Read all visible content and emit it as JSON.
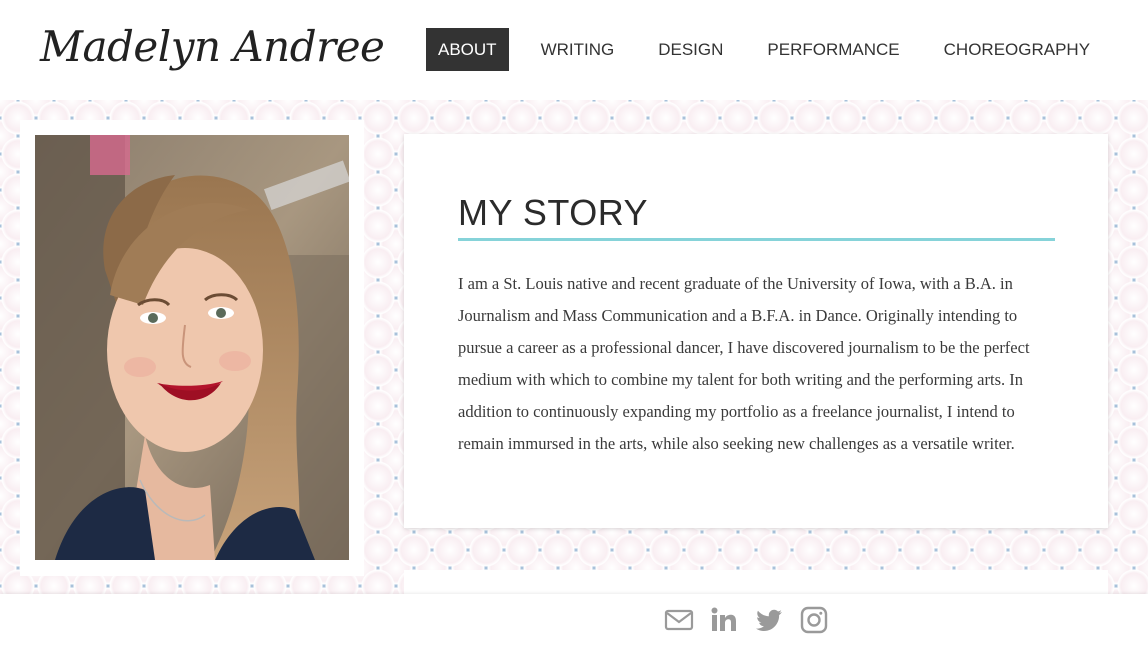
{
  "site": {
    "logo": "Madelyn Andree"
  },
  "nav": {
    "items": [
      {
        "label": "ABOUT",
        "active": true
      },
      {
        "label": "WRITING",
        "active": false
      },
      {
        "label": "DESIGN",
        "active": false
      },
      {
        "label": "PERFORMANCE",
        "active": false
      },
      {
        "label": "CHOREOGRAPHY",
        "active": false
      }
    ]
  },
  "about": {
    "title": "MY STORY",
    "body": "I am a St. Louis native and recent graduate of the University of Iowa, with a B.A. in Journalism and Mass Communication and a B.F.A. in Dance. Originally intending to pursue a career as a professional dancer, I have discovered journalism to be the perfect medium with which to combine my talent for both writing and the performing arts. In addition to continuously expanding my portfolio as a freelance journalist, I intend to remain immursed in the arts, while also seeking new challenges as a versatile writer.",
    "photo": "portrait-photo"
  },
  "footer": {
    "icons": [
      "envelope-icon",
      "linkedin-icon",
      "twitter-icon",
      "instagram-icon"
    ]
  },
  "colors": {
    "accent_rule": "#86d3d9",
    "nav_active_bg": "#333333",
    "pattern_blue": "#a8c1da",
    "icon_gray": "#9a9a9a"
  }
}
